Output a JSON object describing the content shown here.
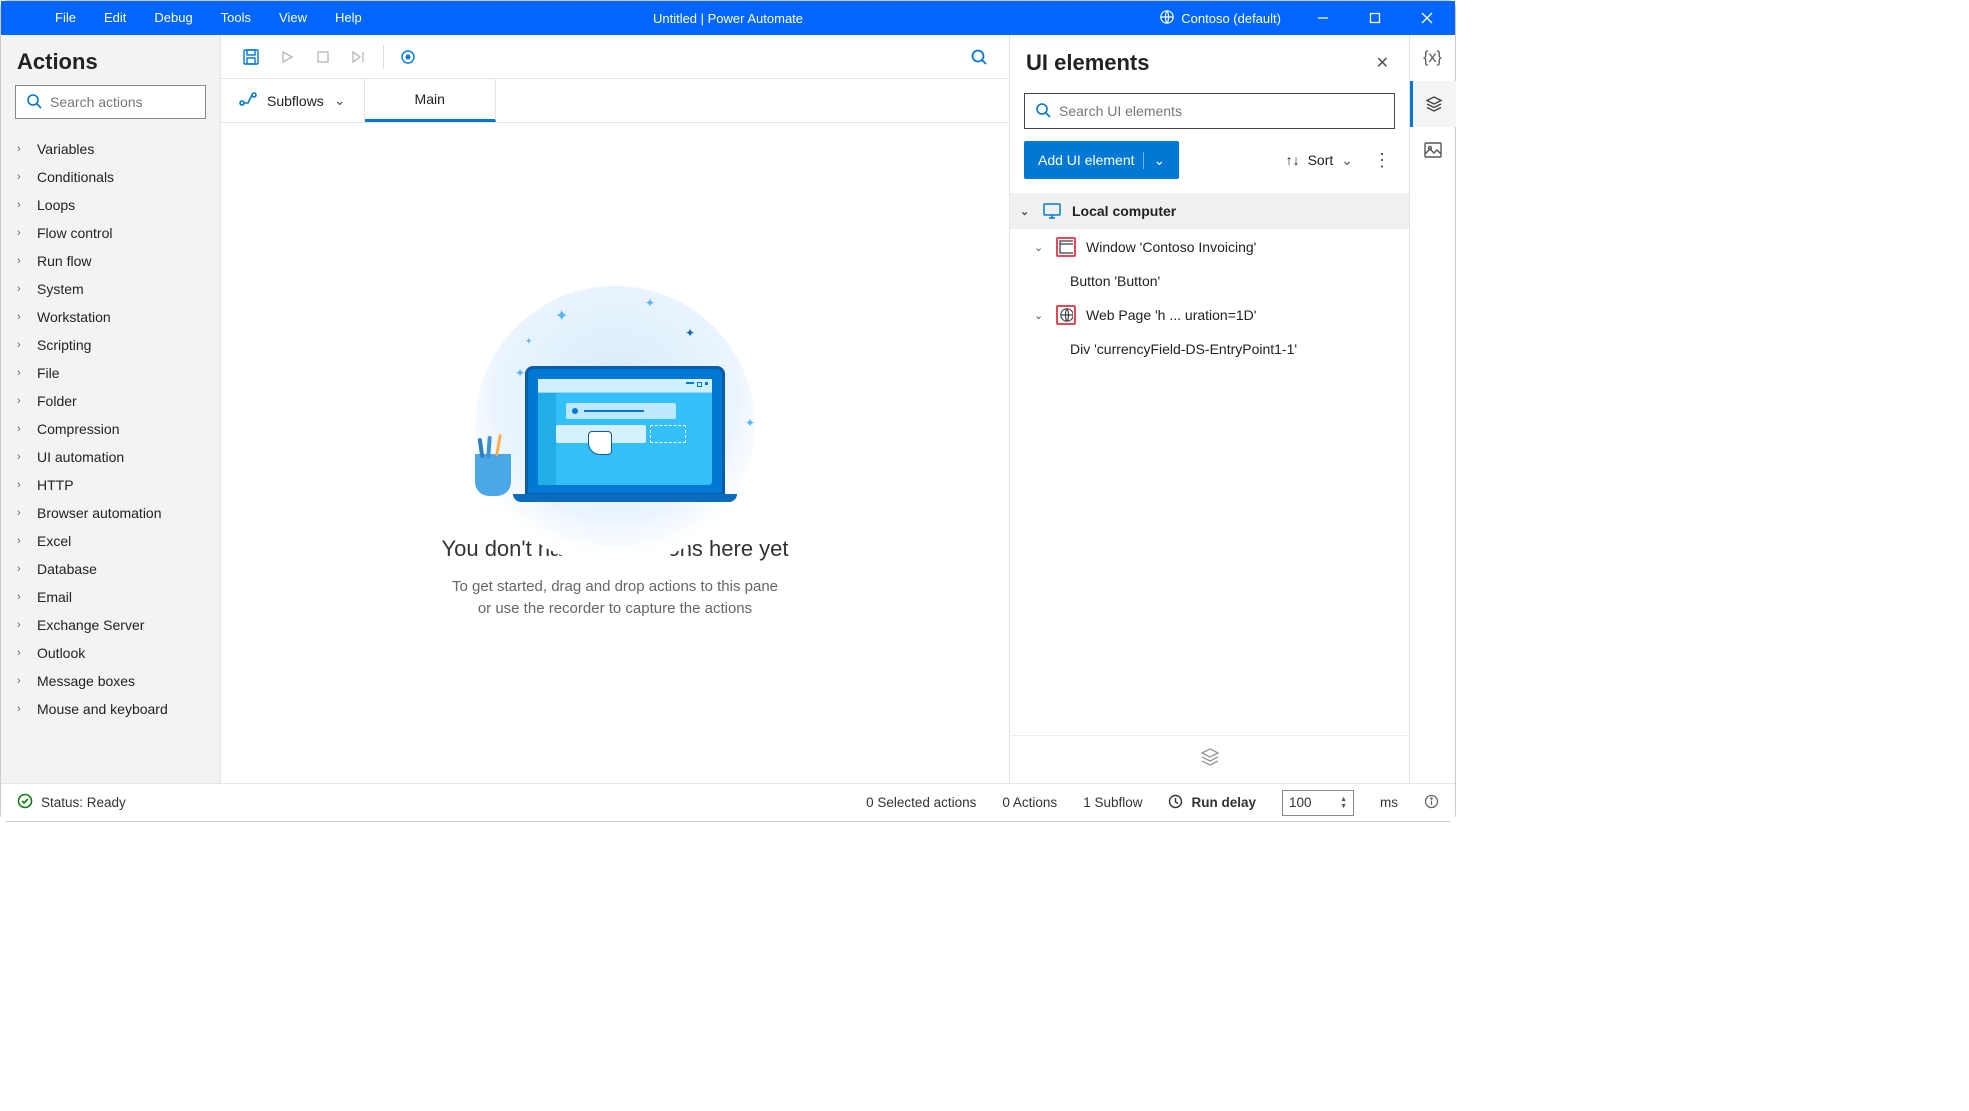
{
  "titlebar": {
    "menus": [
      "File",
      "Edit",
      "Debug",
      "Tools",
      "View",
      "Help"
    ],
    "title": "Untitled | Power Automate",
    "environment": "Contoso (default)"
  },
  "actions_panel": {
    "title": "Actions",
    "search_placeholder": "Search actions",
    "categories": [
      "Variables",
      "Conditionals",
      "Loops",
      "Flow control",
      "Run flow",
      "System",
      "Workstation",
      "Scripting",
      "File",
      "Folder",
      "Compression",
      "UI automation",
      "HTTP",
      "Browser automation",
      "Excel",
      "Database",
      "Email",
      "Exchange Server",
      "Outlook",
      "Message boxes",
      "Mouse and keyboard"
    ]
  },
  "tabs": {
    "subflows_label": "Subflows",
    "main_tab": "Main"
  },
  "empty_state": {
    "title": "You don't have any actions here yet",
    "line1": "To get started, drag and drop actions to this pane",
    "line2": "or use the recorder to capture the actions"
  },
  "right_panel": {
    "title": "UI elements",
    "search_placeholder": "Search UI elements",
    "add_button": "Add UI element",
    "sort_label": "Sort",
    "tree": {
      "root": "Local computer",
      "window": "Window 'Contoso Invoicing'",
      "button": "Button 'Button'",
      "webpage": "Web Page 'h ... uration=1D'",
      "div": "Div 'currencyField-DS-EntryPoint1-1'"
    }
  },
  "statusbar": {
    "status": "Status: Ready",
    "selected": "0 Selected actions",
    "actions": "0 Actions",
    "subflows": "1 Subflow",
    "run_delay_label": "Run delay",
    "run_delay_value": "100",
    "ms": "ms"
  }
}
